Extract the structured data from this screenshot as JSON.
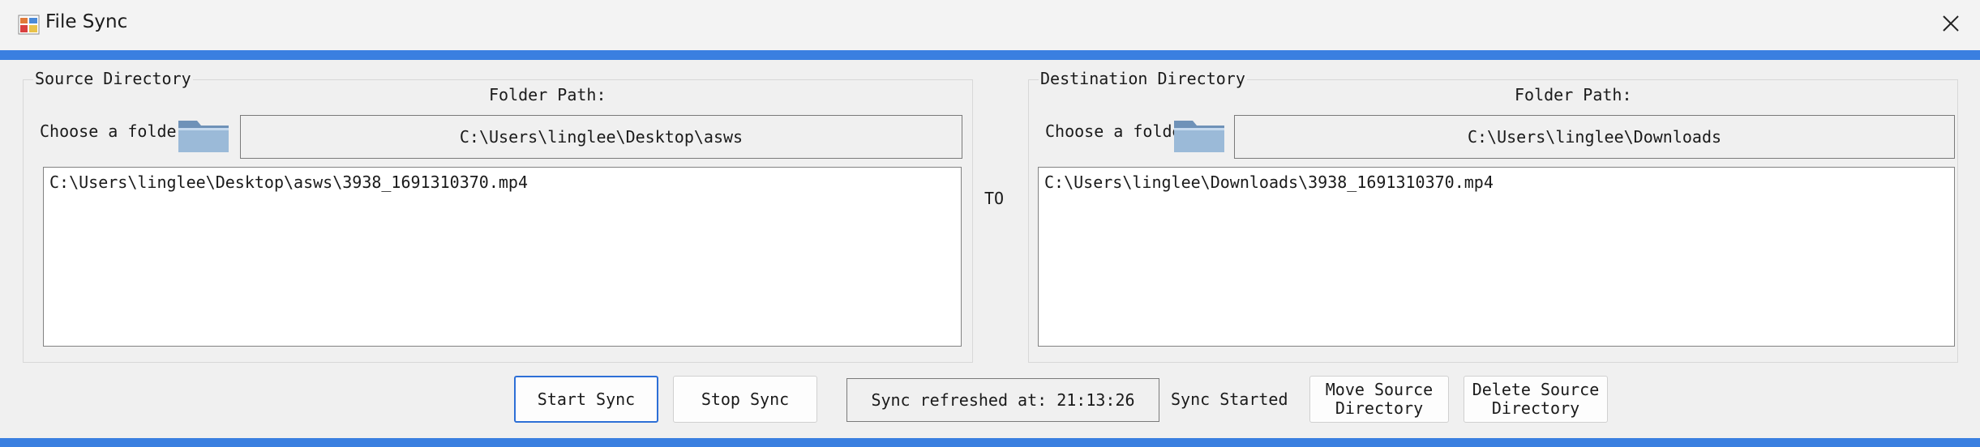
{
  "window": {
    "title": "File Sync",
    "accent_color": "#3a7fe0",
    "close_icon": "close-icon",
    "app_icon": "app-icon"
  },
  "source": {
    "group_title": "Source Directory",
    "folder_path_label": "Folder Path:",
    "choose_label": "Choose a folde",
    "folder_path": "C:\\Users\\linglee\\Desktop\\asws",
    "files": [
      "C:\\Users\\linglee\\Desktop\\asws\\3938_1691310370.mp4"
    ]
  },
  "to_label": "TO",
  "destination": {
    "group_title": "Destination Directory",
    "folder_path_label": "Folder Path:",
    "choose_label": "Choose a folde",
    "folder_path": "C:\\Users\\linglee\\Downloads",
    "files": [
      "C:\\Users\\linglee\\Downloads\\3938_1691310370.mp4"
    ]
  },
  "controls": {
    "start_sync": "Start Sync",
    "stop_sync": "Stop Sync",
    "status_text": "Sync refreshed at: 21:13:26",
    "sync_state": "Sync Started",
    "move_source_line1": "Move Source",
    "move_source_line2": "Directory",
    "delete_source_line1": "Delete Source",
    "delete_source_line2": "Directory"
  }
}
